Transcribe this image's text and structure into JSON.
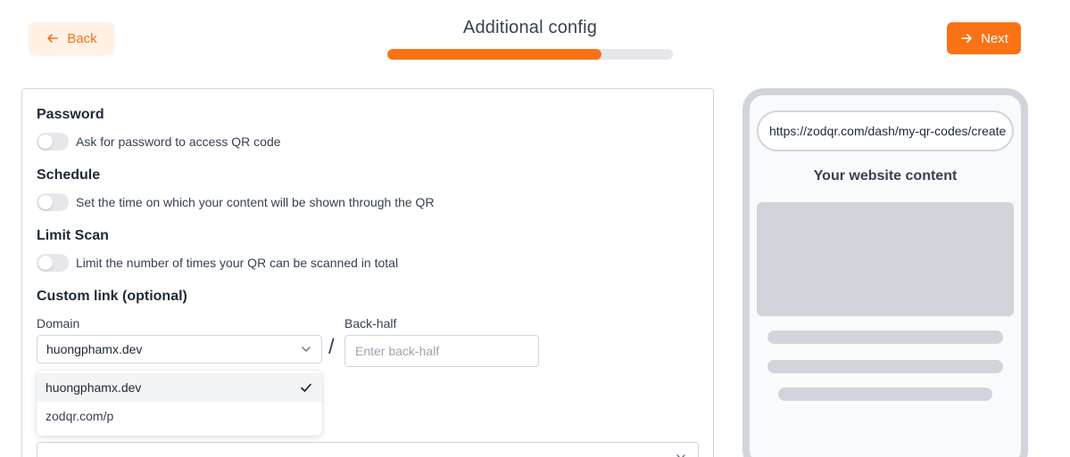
{
  "header": {
    "title": "Additional config",
    "progress": 0.75,
    "back_label": "Back",
    "next_label": "Next"
  },
  "colors": {
    "accent": "#f97316",
    "accent_light": "#fff1e6",
    "track": "#e5e7eb"
  },
  "config": {
    "password": {
      "title": "Password",
      "toggle_label": "Ask for password to access QR code",
      "enabled": false
    },
    "schedule": {
      "title": "Schedule",
      "toggle_label": "Set the time on which your content will be shown through the QR",
      "enabled": false
    },
    "limit_scan": {
      "title": "Limit Scan",
      "toggle_label": "Limit the number of times your QR can be scanned in total",
      "enabled": false
    },
    "custom_link": {
      "title": "Custom link (optional)",
      "domain_label": "Domain",
      "domain_value": "huongphamx.dev",
      "separator": "/",
      "backhalf_label": "Back-half",
      "backhalf_placeholder": "Enter back-half",
      "backhalf_value": "",
      "domain_options": [
        {
          "label": "huongphamx.dev",
          "selected": true
        },
        {
          "label": "zodqr.com/p",
          "selected": false
        }
      ]
    }
  },
  "preview": {
    "url": "https://zodqr.com/dash/my-qr-codes/create",
    "heading": "Your website content"
  },
  "icons": {
    "back": "arrow-left-icon",
    "next": "arrow-right-icon",
    "chevron": "chevron-down-icon",
    "check": "check-icon"
  }
}
